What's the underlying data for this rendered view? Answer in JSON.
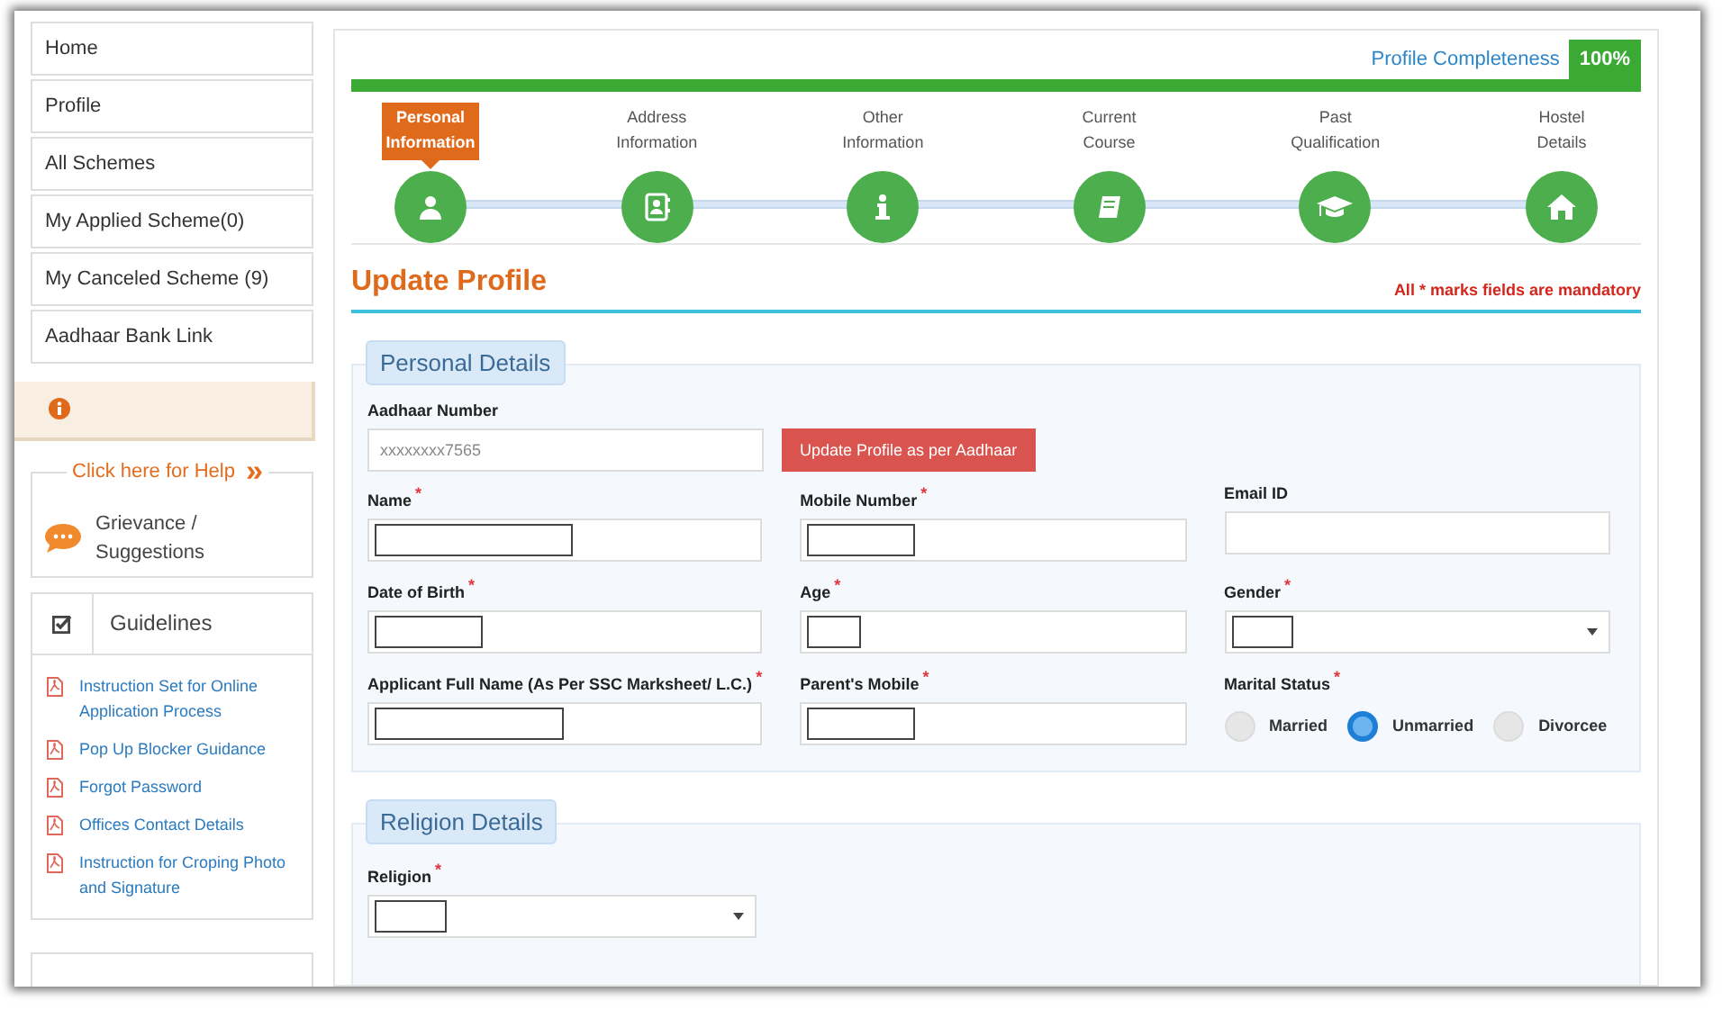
{
  "sidebar": {
    "menu": [
      {
        "label": "Home"
      },
      {
        "label": "Profile"
      },
      {
        "label": "All Schemes"
      },
      {
        "label": "My Applied Scheme(0)"
      },
      {
        "label": "My Canceled Scheme (9)"
      },
      {
        "label": "Aadhaar Bank Link"
      }
    ],
    "help": {
      "title": "Click here for Help",
      "chevrons": "»",
      "item": "Grievance / Suggestions"
    },
    "guidelines": {
      "title": "Guidelines",
      "links": [
        {
          "label": "Instruction Set for Online Application Process"
        },
        {
          "label": "Pop Up Blocker Guidance"
        },
        {
          "label": "Forgot Password"
        },
        {
          "label": "Offices Contact Details"
        },
        {
          "label": "Instruction for Croping Photo and Signature"
        }
      ]
    }
  },
  "completeness": {
    "label": "Profile Completeness",
    "value": "100%",
    "level": 1
  },
  "steps": [
    {
      "label": "Personal Information",
      "selected": true
    },
    {
      "label": "Address Information",
      "selected": false
    },
    {
      "label": "Other Information",
      "selected": false
    },
    {
      "label": "Current Course",
      "selected": false
    },
    {
      "label": "Past Qualification",
      "selected": false
    },
    {
      "label": "Hostel Details",
      "selected": false
    }
  ],
  "title": "Update Profile",
  "mandatory_note": "All * marks fields are mandatory",
  "personal": {
    "legend": "Personal Details",
    "aadhaar": {
      "label": "Aadhaar Number",
      "value": "xxxxxxxx7565",
      "button": "Update Profile as per Aadhaar"
    },
    "fields": [
      {
        "label": "Name",
        "required_mark": "*",
        "kind": "text",
        "masked": true
      },
      {
        "label": "Mobile Number",
        "required_mark": "*",
        "kind": "text",
        "masked": true
      },
      {
        "label": "Email ID",
        "kind": "text",
        "masked": false
      },
      {
        "label": "Date of Birth",
        "required_mark": "*",
        "kind": "text",
        "masked": true
      },
      {
        "label": "Age",
        "required_mark": "*",
        "kind": "text",
        "masked": true
      },
      {
        "label": "Gender",
        "required_mark": "*",
        "kind": "select",
        "masked": true
      },
      {
        "label": "Applicant Full Name (As Per SSC Marksheet/ L.C.)",
        "required_mark": "*",
        "kind": "text",
        "masked": true
      },
      {
        "label": "Parent's Mobile",
        "required_mark": "*",
        "kind": "text",
        "masked": true
      },
      {
        "label": "Marital Status",
        "required_mark": "*",
        "kind": "radio",
        "options": [
          {
            "label": "Married",
            "selected": false
          },
          {
            "label": "Unmarried",
            "selected": true
          },
          {
            "label": "Divorcee",
            "selected": false
          }
        ]
      }
    ]
  },
  "religion": {
    "legend": "Religion Details",
    "fields": [
      {
        "label": "Religion",
        "required_mark": "*",
        "kind": "select",
        "masked": true
      }
    ]
  }
}
